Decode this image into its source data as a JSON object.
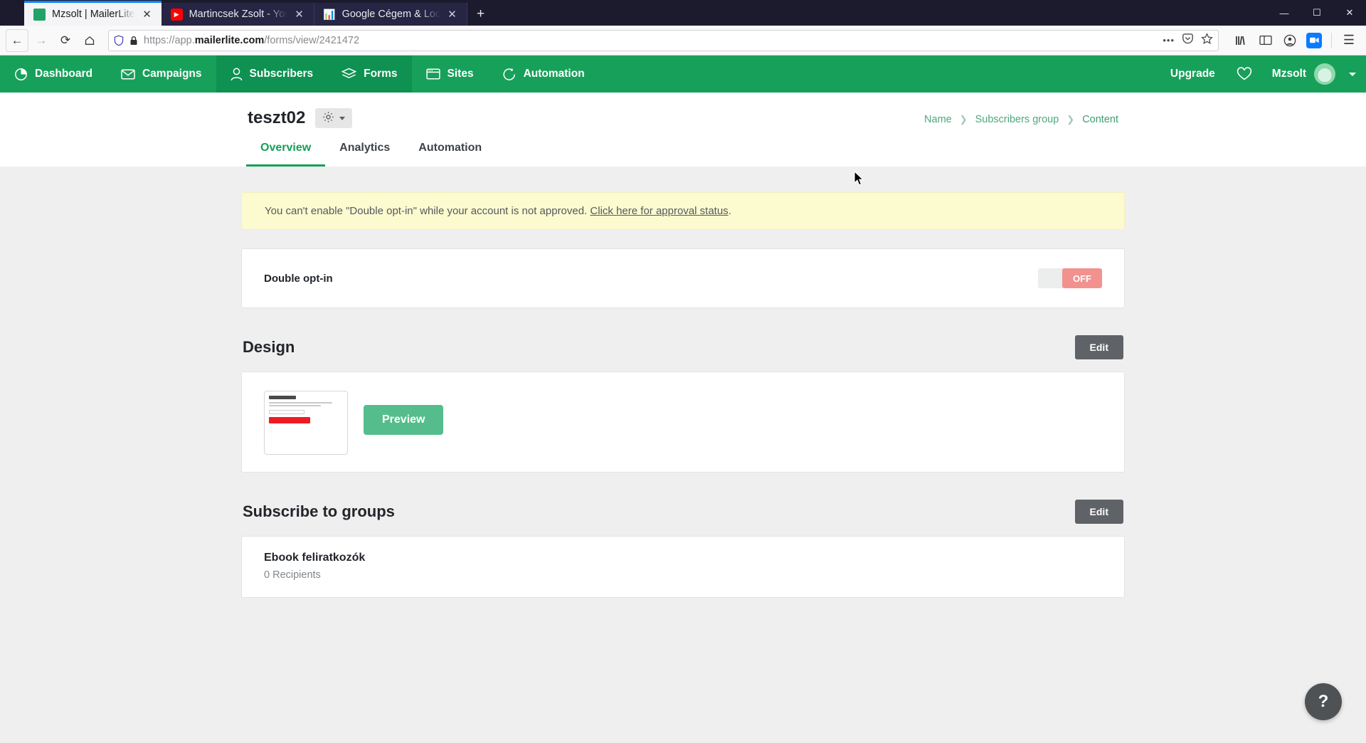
{
  "browser": {
    "tabs": [
      {
        "title": "Mzsolt | MailerLite",
        "favicon": "mailerlite-favicon",
        "active": true
      },
      {
        "title": "Martincsek Zsolt - YouTube",
        "favicon": "youtube-favicon",
        "active": false
      },
      {
        "title": "Google Cégem & Local SEO be",
        "favicon": "seo-chart-favicon",
        "active": false
      }
    ],
    "new_tab_label": "+",
    "window_controls": {
      "minimize": "—",
      "maximize": "❒",
      "close": "✕"
    },
    "toolbar": {
      "back": "←",
      "forward": "→",
      "reload": "⟳",
      "home": "⌂",
      "url_prefix": "https://app.",
      "url_domain": "mailerlite.com",
      "url_path": "/forms/view/2421472",
      "more_actions": "•••",
      "pocket": "pocket-icon",
      "bookmark": "star-icon",
      "library": "library-icon",
      "sidebar": "sidebar-icon",
      "account": "account-icon",
      "zoom_ext": "zoom-extension-icon",
      "menu": "☰"
    }
  },
  "app_nav": {
    "items": [
      {
        "label": "Dashboard",
        "icon": "dashboard-icon",
        "highlighted": false
      },
      {
        "label": "Campaigns",
        "icon": "envelope-icon",
        "highlighted": false
      },
      {
        "label": "Subscribers",
        "icon": "person-icon",
        "highlighted": true
      },
      {
        "label": "Forms",
        "icon": "layers-icon",
        "highlighted": true
      },
      {
        "label": "Sites",
        "icon": "browser-window-icon",
        "highlighted": false
      },
      {
        "label": "Automation",
        "icon": "refresh-arrow-icon",
        "highlighted": false
      }
    ],
    "upgrade_label": "Upgrade",
    "heart_icon": "heart-icon",
    "user_name": "Mzsolt",
    "avatar": "user-avatar"
  },
  "page_header": {
    "title": "teszt02",
    "gear_icon": "gear-icon",
    "breadcrumb": [
      {
        "label": "Name"
      },
      {
        "label": "Subscribers group"
      },
      {
        "label": "Content"
      }
    ],
    "breadcrumb_separator": "❯",
    "tabs": [
      {
        "label": "Overview",
        "active": true
      },
      {
        "label": "Analytics",
        "active": false
      },
      {
        "label": "Automation",
        "active": false
      }
    ]
  },
  "main": {
    "alert": {
      "text_before": "You can't enable \"Double opt-in\" while your account is not approved. ",
      "link_text": "Click here for approval status",
      "text_after": "."
    },
    "double_optin": {
      "label": "Double opt-in",
      "toggle_state": "OFF",
      "toggle_color": "#f2928f"
    },
    "design": {
      "title": "Design",
      "edit_label": "Edit",
      "preview_label": "Preview",
      "preview_color": "#54bd8b",
      "thumbnail": "form-thumbnail"
    },
    "subscribe_groups": {
      "title": "Subscribe to groups",
      "edit_label": "Edit",
      "groups": [
        {
          "name": "Ebook feliratkozók",
          "recipients": "0 Recipients"
        }
      ]
    },
    "help_fab": "?"
  },
  "colors": {
    "brand_green": "#17a05a",
    "brand_green_dark": "#0e9151",
    "accent_green": "#54bd8b",
    "alert_yellow": "#fcfbd0",
    "toggle_off": "#f2928f",
    "dark_button": "#5f6266"
  }
}
